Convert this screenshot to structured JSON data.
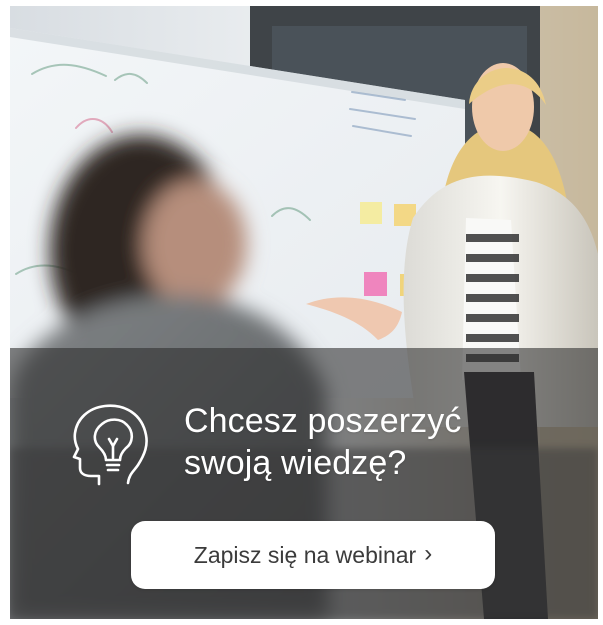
{
  "banner": {
    "headline_line_1": "Chcesz poszerzyć",
    "headline_line_2": "swoją wiedzę?",
    "cta_label": "Zapisz się na webinar",
    "cta_chevron": "›",
    "icon_name": "idea-head-icon",
    "photo_description": "",
    "colors": {
      "overlay": "#2d2d2d",
      "text": "#ffffff",
      "button_bg": "#ffffff",
      "button_text": "#3b3b3b"
    }
  }
}
